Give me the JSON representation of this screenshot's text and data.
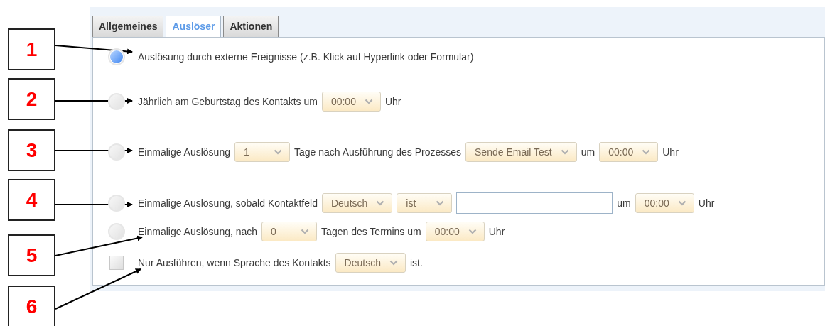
{
  "tabs": [
    {
      "label": "Allgemeines",
      "selected": false
    },
    {
      "label": "Auslöser",
      "selected": true
    },
    {
      "label": "Aktionen",
      "selected": false
    }
  ],
  "options": [
    {
      "kind": "radio",
      "selected": true,
      "parts": [
        {
          "kind": "text",
          "text": "Auslösung durch externe Ereignisse (z.B. Klick auf Hyperlink oder Formular)"
        }
      ]
    },
    {
      "kind": "radio",
      "selected": false,
      "parts": [
        {
          "kind": "text",
          "text": "Jährlich am Geburtstag des Kontakts um"
        },
        {
          "kind": "select",
          "value": "00:00"
        },
        {
          "kind": "text",
          "text": "Uhr"
        }
      ]
    },
    {
      "kind": "radio",
      "selected": false,
      "parts": [
        {
          "kind": "text",
          "text": "Einmalige Auslösung"
        },
        {
          "kind": "select",
          "value": "1"
        },
        {
          "kind": "text",
          "text": "Tage nach Ausführung des Prozesses"
        },
        {
          "kind": "select",
          "value": "Sende Email Test"
        },
        {
          "kind": "text",
          "text": "um"
        },
        {
          "kind": "select",
          "value": "00:00"
        },
        {
          "kind": "text",
          "text": "Uhr"
        }
      ]
    },
    {
      "kind": "radio",
      "selected": false,
      "parts": [
        {
          "kind": "text",
          "text": "Einmalige Auslösung, sobald Kontaktfeld"
        },
        {
          "kind": "select",
          "value": "Deutsch"
        },
        {
          "kind": "select",
          "value": "ist"
        },
        {
          "kind": "input"
        },
        {
          "kind": "text",
          "text": "um"
        },
        {
          "kind": "select",
          "value": "00:00"
        },
        {
          "kind": "text",
          "text": "Uhr"
        }
      ]
    },
    {
      "kind": "radio",
      "selected": false,
      "parts": [
        {
          "kind": "text",
          "text": "Einmalige Auslösung, nach"
        },
        {
          "kind": "select",
          "value": "0"
        },
        {
          "kind": "text",
          "text": "Tagen des Termins um"
        },
        {
          "kind": "select",
          "value": "00:00"
        },
        {
          "kind": "text",
          "text": "Uhr"
        }
      ]
    },
    {
      "kind": "checkbox",
      "checked": false,
      "parts": [
        {
          "kind": "text",
          "text": "Nur Ausführen, wenn Sprache des Kontakts"
        },
        {
          "kind": "select",
          "value": "Deutsch"
        },
        {
          "kind": "text",
          "text": "ist."
        }
      ]
    }
  ],
  "callouts": [
    {
      "label": "1"
    },
    {
      "label": "2"
    },
    {
      "label": "3"
    },
    {
      "label": "4"
    },
    {
      "label": "5"
    },
    {
      "label": "6"
    }
  ]
}
